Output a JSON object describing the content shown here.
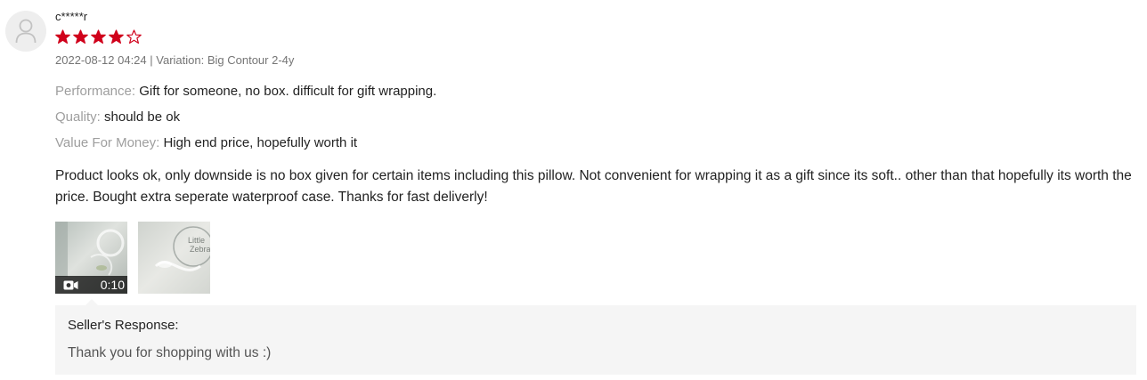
{
  "review": {
    "author": "c*****r",
    "rating": 4,
    "max_rating": 5,
    "date": "2022-08-12 04:24",
    "separator": " | ",
    "variation": "Variation: Big Contour 2-4y",
    "attributes": [
      {
        "key": "Performance:",
        "value": "Gift for someone, no box. difficult for gift wrapping."
      },
      {
        "key": "Quality:",
        "value": "should be ok"
      },
      {
        "key": "Value For Money:",
        "value": "High end price, hopefully worth it"
      }
    ],
    "body": "Product looks ok, only downside is no box given for certain items including this pillow. Not convenient for wrapping it as a gift since its soft.. other than that hopefully its worth the price. Bought extra seperate waterproof case. Thanks for fast deliverly!",
    "media": [
      {
        "type": "video",
        "duration": "0:10",
        "icon": "video-camera-icon"
      },
      {
        "type": "photo",
        "overlay_text": "Little Zebra"
      }
    ],
    "seller_response": {
      "title": "Seller's Response:",
      "text": "Thank you for shopping with us :)"
    }
  },
  "colors": {
    "star": "#d0011b",
    "muted": "#757575",
    "label": "#9e9e9e",
    "panel": "#f5f5f5"
  }
}
